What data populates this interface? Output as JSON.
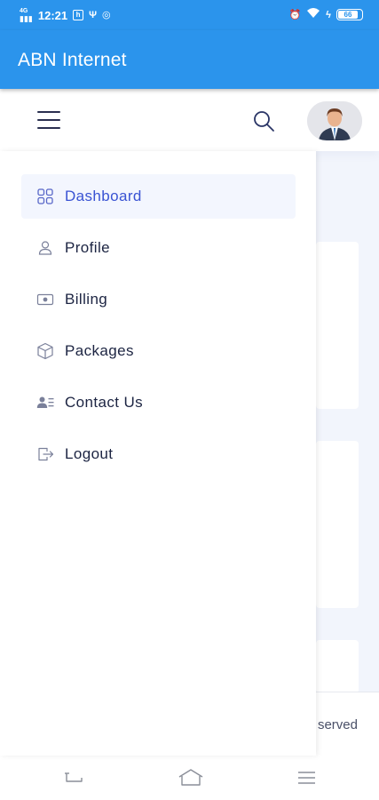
{
  "status_bar": {
    "time": "12:21",
    "network": "4G",
    "battery": "66"
  },
  "app_bar": {
    "title": "ABN Internet"
  },
  "menu": [
    {
      "label": "Dashboard",
      "icon": "grid-icon",
      "active": true
    },
    {
      "label": "Profile",
      "icon": "user-icon",
      "active": false
    },
    {
      "label": "Billing",
      "icon": "card-icon",
      "active": false
    },
    {
      "label": "Packages",
      "icon": "box-icon",
      "active": false
    },
    {
      "label": "Contact Us",
      "icon": "contact-icon",
      "active": false
    },
    {
      "label": "Logout",
      "icon": "logout-icon",
      "active": false
    }
  ],
  "footer": {
    "text": "served"
  },
  "colors": {
    "primary": "#2b94ec",
    "active_text": "#3953d3",
    "active_bg": "#f3f6fe",
    "text": "#1c2442"
  }
}
